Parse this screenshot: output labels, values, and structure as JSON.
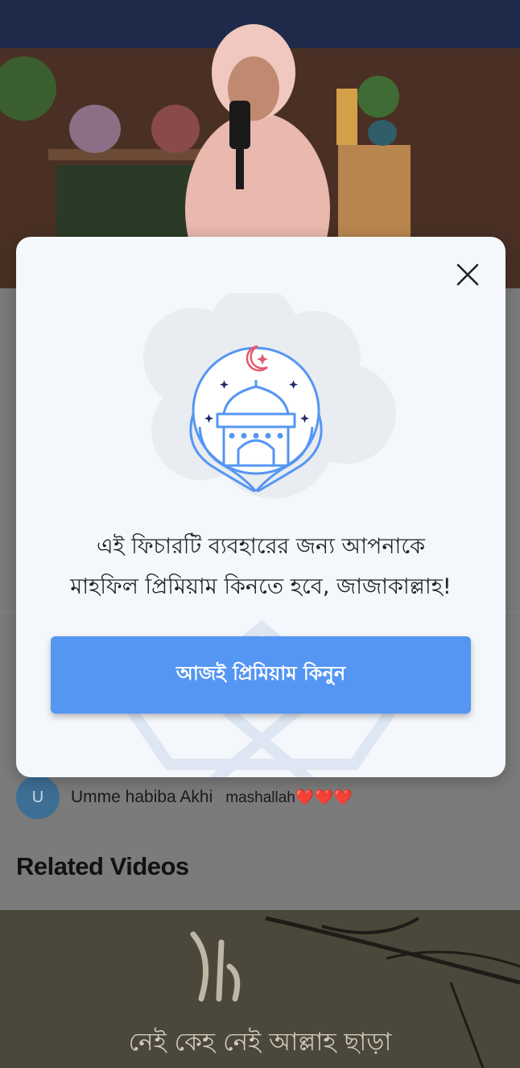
{
  "modal": {
    "message_line1": "এই ফিচারটি ব্যবহারের জন্য আপনাকে",
    "message_line2": "মাহফিল প্রিমিয়াম কিনতে হবে, জাজাকাল্লাহ!",
    "button_label": "আজই প্রিমিয়াম কিনুন",
    "icon": "mosque-hands-icon",
    "close_icon": "close-icon",
    "accent_color": "#5596f3"
  },
  "comment": {
    "avatar_initial": "U",
    "user": "Umme habiba Akhi",
    "text": "mashallah❤️❤️❤️"
  },
  "related": {
    "title": "Related Videos",
    "thumb_caption": "নেই কেহ নেই আল্লাহ ছাড়া"
  }
}
